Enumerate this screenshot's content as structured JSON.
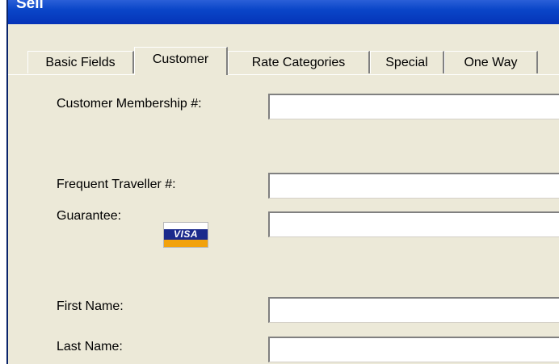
{
  "window": {
    "title": "Sell"
  },
  "tabs": [
    {
      "label": "Basic Fields",
      "active": false
    },
    {
      "label": "Customer",
      "active": true
    },
    {
      "label": "Rate Categories",
      "active": false
    },
    {
      "label": "Special",
      "active": false
    },
    {
      "label": "One Way",
      "active": false
    }
  ],
  "form": {
    "customer_membership_label": "Customer Membership #:",
    "customer_membership_value": "",
    "frequent_traveller_label": "Frequent Traveller #:",
    "frequent_traveller_value": "",
    "guarantee_label": "Guarantee:",
    "guarantee_value": "",
    "guarantee_card": "VISA",
    "first_name_label": "First Name:",
    "first_name_value": "",
    "last_name_label": "Last Name:",
    "last_name_value": ""
  },
  "colors": {
    "window_bg": "#ece9d8",
    "titlebar": "#0a46c8",
    "visa_blue": "#1a2a8c",
    "visa_gold": "#f2a20c"
  }
}
